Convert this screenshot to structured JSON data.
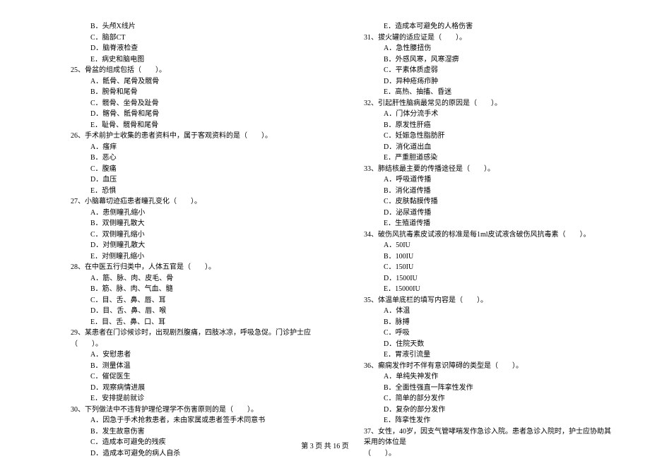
{
  "left": {
    "lines": [
      {
        "cls": "option",
        "t": "B．头颅X线片"
      },
      {
        "cls": "option",
        "t": "C．脑部CT"
      },
      {
        "cls": "option",
        "t": "D．脑脊液检查"
      },
      {
        "cls": "option",
        "t": "E．病史和脑电图"
      },
      {
        "cls": "question",
        "t": "25、骨盆的组成包括（　　）。"
      },
      {
        "cls": "option",
        "t": "A．骶骨、尾骨及髋骨"
      },
      {
        "cls": "option",
        "t": "B．腕骨和尾骨"
      },
      {
        "cls": "option",
        "t": "C．髋骨、坐骨及趾骨"
      },
      {
        "cls": "option",
        "t": "D．髂骨、骶骨和尾骨"
      },
      {
        "cls": "option",
        "t": "E．耻骨、髋骨和尾骨"
      },
      {
        "cls": "question",
        "t": "26、手术前护士收集的患者资料中，属于客观资料的是（　　）。"
      },
      {
        "cls": "option",
        "t": "A．瘙痒"
      },
      {
        "cls": "option",
        "t": "B．恶心"
      },
      {
        "cls": "option",
        "t": "C．腹痛"
      },
      {
        "cls": "option",
        "t": "D．血压"
      },
      {
        "cls": "option",
        "t": "E．恐惧"
      },
      {
        "cls": "question",
        "t": "27、小脑幕切迹疝患者瞳孔变化（　　）。"
      },
      {
        "cls": "option",
        "t": "A．患侧瞳孔缩小"
      },
      {
        "cls": "option",
        "t": "B．双侧瞳孔散大"
      },
      {
        "cls": "option",
        "t": "C．双侧瞳孔缩小"
      },
      {
        "cls": "option",
        "t": "D．对侧瞳孔散大"
      },
      {
        "cls": "option",
        "t": "E．对侧瞳孔缩小"
      },
      {
        "cls": "question",
        "t": "28、在中医五行归类中，人体五官是（　　）。"
      },
      {
        "cls": "option",
        "t": "A．筋、脉、肉、皮毛、骨"
      },
      {
        "cls": "option",
        "t": "B．筋、脉、肉、气血、髓"
      },
      {
        "cls": "option",
        "t": "C．目、舌、鼻、唇、耳"
      },
      {
        "cls": "option",
        "t": "D．目、舌、鼻、唇、喉"
      },
      {
        "cls": "option",
        "t": "E．目、舌、鼻、口、耳"
      },
      {
        "cls": "question",
        "t": "29、某患者在门诊候诊时，出现剧烈腹痛，四肢冰凉，呼吸急促。门诊护士应（　　）。"
      },
      {
        "cls": "option",
        "t": "A．安慰患者"
      },
      {
        "cls": "option",
        "t": "B．测量体温"
      },
      {
        "cls": "option",
        "t": "C．催促医生"
      },
      {
        "cls": "option",
        "t": "D．观察病情进展"
      },
      {
        "cls": "option",
        "t": "E．安排提前就诊"
      },
      {
        "cls": "question",
        "t": "30、下列做法中不违背护理伦理学不伤害原则的是（　　）。"
      },
      {
        "cls": "option",
        "t": "A．因急于手术抢救患者，未由家属或患者签手术同意书"
      },
      {
        "cls": "option",
        "t": "B．发生故意伤害"
      },
      {
        "cls": "option",
        "t": "C．造成本可避免的残疾"
      },
      {
        "cls": "option",
        "t": "D．造成本可避免的病人自杀"
      }
    ]
  },
  "right": {
    "lines": [
      {
        "cls": "option",
        "t": "E．造成本可避免的人格伤害"
      },
      {
        "cls": "question",
        "t": "31、拔火罐的适应证是（　　）。"
      },
      {
        "cls": "option",
        "t": "A．急性腰扭伤"
      },
      {
        "cls": "option",
        "t": "B．外感风寒，风寒湿痹"
      },
      {
        "cls": "option",
        "t": "C．平素体质虚弱"
      },
      {
        "cls": "option",
        "t": "D．异种疮疡疖肿"
      },
      {
        "cls": "option",
        "t": "E．高热、抽搐、昏迷"
      },
      {
        "cls": "question",
        "t": "32、引起肝性脑病最常见的原因是（　　）。"
      },
      {
        "cls": "option",
        "t": "A．门体分流手术"
      },
      {
        "cls": "option",
        "t": "B．原发性肝癌"
      },
      {
        "cls": "option",
        "t": "C．妊娠急性脂肪肝"
      },
      {
        "cls": "option",
        "t": "D．消化道出血"
      },
      {
        "cls": "option",
        "t": "E．严重胆道感染"
      },
      {
        "cls": "question",
        "t": "33、肺结核最主要的传播途径是（　　）。"
      },
      {
        "cls": "option",
        "t": "A．呼吸道传播"
      },
      {
        "cls": "option",
        "t": "B．消化道传播"
      },
      {
        "cls": "option",
        "t": "C．皮肤黏膜传播"
      },
      {
        "cls": "option",
        "t": "D．泌尿道传播"
      },
      {
        "cls": "option",
        "t": "E．生殖道传播"
      },
      {
        "cls": "question",
        "t": "34、破伤风抗毒素皮试液的标准是每1ml皮试液含破伤风抗毒素（　　）。"
      },
      {
        "cls": "option",
        "t": "A．50IU"
      },
      {
        "cls": "option",
        "t": "B．100IU"
      },
      {
        "cls": "option",
        "t": "C．150IU"
      },
      {
        "cls": "option",
        "t": "D．1500IU"
      },
      {
        "cls": "option",
        "t": "E．15000IU"
      },
      {
        "cls": "question",
        "t": "35、体温单底栏的填写内容是（　　）。"
      },
      {
        "cls": "option",
        "t": "A．体温"
      },
      {
        "cls": "option",
        "t": "B．脉搏"
      },
      {
        "cls": "option",
        "t": "C．呼吸"
      },
      {
        "cls": "option",
        "t": "D．住院天数"
      },
      {
        "cls": "option",
        "t": "E．胃液引流量"
      },
      {
        "cls": "question",
        "t": "36、癫痫发作时不伴有意识障碍的类型是（　　）。"
      },
      {
        "cls": "option",
        "t": "A．单纯失神发作"
      },
      {
        "cls": "option",
        "t": "B．全面性强直一阵挛性发作"
      },
      {
        "cls": "option",
        "t": "C．简单的部分发作"
      },
      {
        "cls": "option",
        "t": "D．复杂的部分发作"
      },
      {
        "cls": "option",
        "t": "E．阵挛性发作"
      },
      {
        "cls": "question",
        "t": "37、女性，40岁，因支气管哮喘发作急诊入院。患者急诊入院时，护士应协助其采用的体位是"
      },
      {
        "cls": "question",
        "t": "（　　）。"
      }
    ]
  },
  "footer": "第 3 页 共 16 页"
}
